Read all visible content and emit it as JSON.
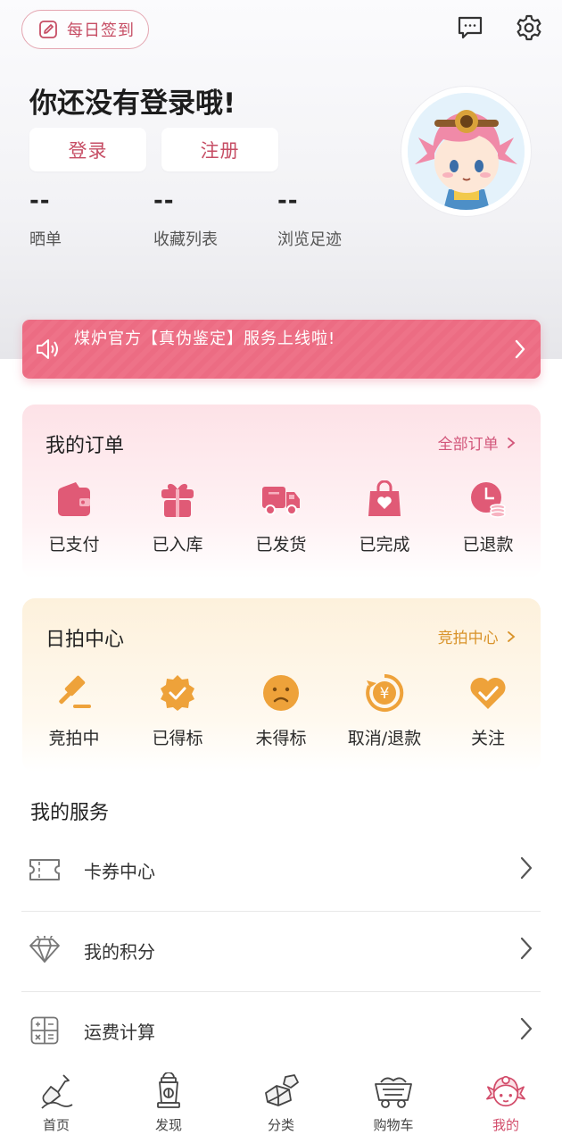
{
  "header": {
    "signin_label": "每日签到",
    "title": "你还没有登录哦!",
    "login_label": "登录",
    "register_label": "注册"
  },
  "stats": [
    {
      "value": "--",
      "label": "晒单"
    },
    {
      "value": "--",
      "label": "收藏列表"
    },
    {
      "value": "--",
      "label": "浏览足迹"
    }
  ],
  "banner": {
    "text": "煤炉官方【真伪鉴定】服务上线啦!"
  },
  "orders": {
    "title": "我的订单",
    "link": "全部订单",
    "items": [
      {
        "label": "已支付",
        "icon": "wallet-icon"
      },
      {
        "label": "已入库",
        "icon": "gift-icon"
      },
      {
        "label": "已发货",
        "icon": "truck-icon"
      },
      {
        "label": "已完成",
        "icon": "bag-heart-icon"
      },
      {
        "label": "已退款",
        "icon": "refund-coin-icon"
      }
    ]
  },
  "auction": {
    "title": "日拍中心",
    "link": "竞拍中心",
    "items": [
      {
        "label": "竞拍中",
        "icon": "gavel-icon"
      },
      {
        "label": "已得标",
        "icon": "badge-check-icon"
      },
      {
        "label": "未得标",
        "icon": "sad-face-icon"
      },
      {
        "label": "取消/退款",
        "icon": "yen-refund-icon"
      },
      {
        "label": "关注",
        "icon": "heart-check-icon"
      }
    ]
  },
  "services": {
    "title": "我的服务",
    "rows": [
      {
        "label": "卡券中心",
        "icon": "ticket-icon"
      },
      {
        "label": "我的积分",
        "icon": "diamond-icon"
      },
      {
        "label": "运费计算",
        "icon": "calculator-icon"
      }
    ]
  },
  "tabs": [
    {
      "label": "首页",
      "icon": "shovel-icon"
    },
    {
      "label": "发现",
      "icon": "lantern-icon"
    },
    {
      "label": "分类",
      "icon": "coal-icon"
    },
    {
      "label": "购物车",
      "icon": "mine-cart-icon"
    },
    {
      "label": "我的",
      "icon": "avatar-girl-icon",
      "active": true
    }
  ],
  "colors": {
    "accent": "#d24c6a",
    "banner": "#ee7288",
    "order_icon": "#e05a76",
    "auction_icon": "#eea23a",
    "auction_link": "#d9932a"
  }
}
